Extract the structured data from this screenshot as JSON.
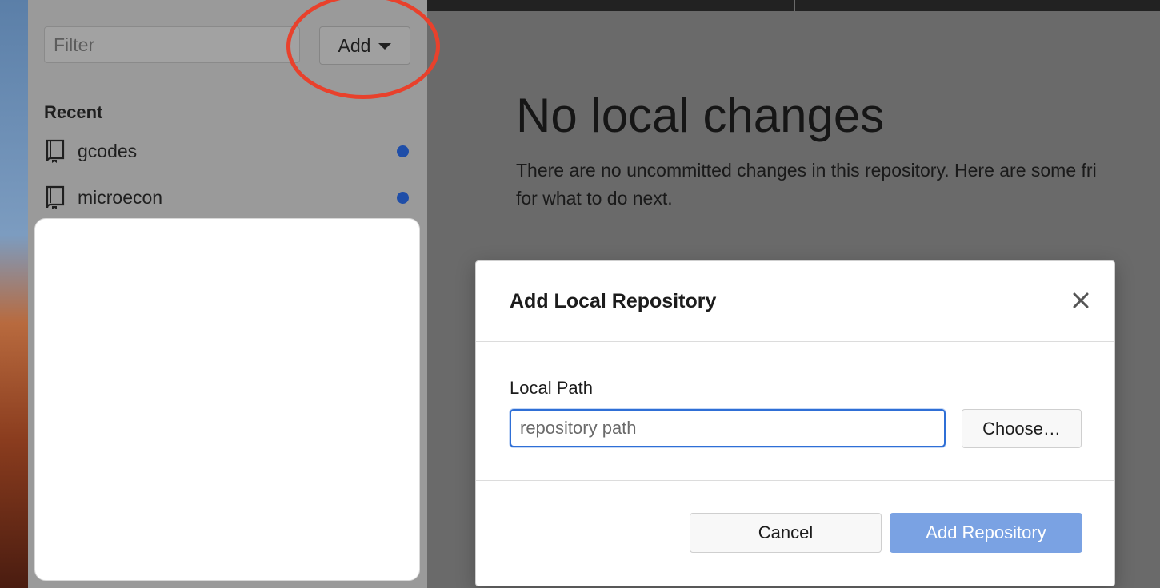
{
  "sidebar": {
    "filter_placeholder": "Filter",
    "add_label": "Add",
    "section_header": "Recent",
    "repos": [
      {
        "name": "gcodes",
        "badge_color": "#1f4ea8"
      },
      {
        "name": "microecon",
        "badge_color": "#1f4ea8"
      }
    ]
  },
  "main": {
    "title": "No local changes",
    "description_line1": "There are no uncommitted changes in this repository. Here are some fri",
    "description_line2": "for what to do next."
  },
  "dialog": {
    "title": "Add Local Repository",
    "field_label": "Local Path",
    "path_placeholder": "repository path",
    "path_value": "",
    "choose_label": "Choose…",
    "cancel_label": "Cancel",
    "submit_label": "Add Repository"
  },
  "colors": {
    "accent": "#2f6fd6",
    "primary_disabled": "#7aa2e3",
    "highlight": "#e8412c"
  }
}
